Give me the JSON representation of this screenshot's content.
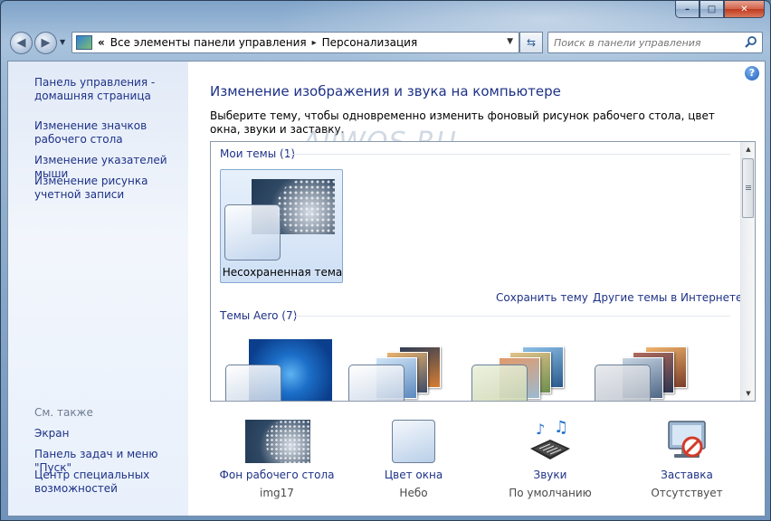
{
  "window": {
    "caption_minimize": "–",
    "caption_maximize": "□",
    "caption_close": "✕"
  },
  "address_bar": {
    "chevron": "«",
    "crumbs": [
      "Все элементы панели управления",
      "Персонализация"
    ],
    "separator": "▸"
  },
  "search": {
    "placeholder": "Поиск в панели управления"
  },
  "sidebar": {
    "links": [
      {
        "label": "Панель управления -\nдомашняя страница"
      },
      {
        "label": "Изменение значков рабочего стола"
      },
      {
        "label": "Изменение указателей мыши"
      },
      {
        "label": "Изменение рисунка учетной записи"
      }
    ],
    "see_also_heading": "См. также",
    "see_also": [
      {
        "label": "Экран"
      },
      {
        "label": "Панель задач и меню \"Пуск\""
      },
      {
        "label": "Центр специальных возможностей"
      }
    ]
  },
  "main": {
    "title": "Изменение изображения и звука на компьютере",
    "description": "Выберите тему, чтобы одновременно изменить фоновый рисунок рабочего стола, цвет окна, звуки и заставку.",
    "watermark": "AllWOS.RU"
  },
  "themes": {
    "my_themes_label": "Мои темы (1)",
    "unsaved_theme_label": "Несохраненная тема",
    "save_theme_link": "Сохранить тему",
    "more_themes_link": "Другие темы в Интернете",
    "aero_label": "Темы Aero (7)"
  },
  "bottom": [
    {
      "link": "Фон рабочего стола",
      "value": "img17",
      "icon": "desktop-background-icon"
    },
    {
      "link": "Цвет окна",
      "value": "Небо",
      "icon": "window-color-icon"
    },
    {
      "link": "Звуки",
      "value": "По умолчанию",
      "icon": "sounds-icon"
    },
    {
      "link": "Заставка",
      "value": "Отсутствует",
      "icon": "screensaver-icon"
    }
  ],
  "colors": {
    "link": "#1e3287",
    "sidebar_bg": "#e8f0fb",
    "selected_tile": "#cfe0f5"
  }
}
